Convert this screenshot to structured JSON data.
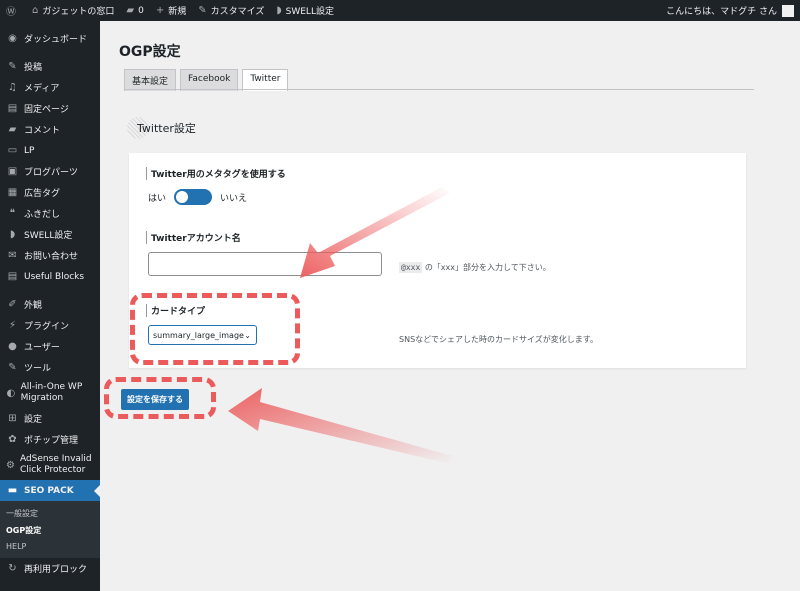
{
  "adminbar": {
    "wp_icon": "wordpress-icon",
    "site_name": "ガジェットの窓口",
    "comments_count": "0",
    "new_label": "新規",
    "customize_label": "カスタマイズ",
    "swell_label": "SWELL設定",
    "greeting": "こんにちは、マドグチ さん"
  },
  "sidebar": {
    "items": [
      {
        "icon": "dashboard-icon",
        "label": "ダッシュボード"
      },
      {
        "icon": "pin-icon",
        "label": "投稿"
      },
      {
        "icon": "media-icon",
        "label": "メディア"
      },
      {
        "icon": "page-icon",
        "label": "固定ページ"
      },
      {
        "icon": "comment-icon",
        "label": "コメント"
      },
      {
        "icon": "lp-icon",
        "label": "LP"
      },
      {
        "icon": "blog-parts-icon",
        "label": "ブログパーツ"
      },
      {
        "icon": "ad-tag-icon",
        "label": "広告タグ"
      },
      {
        "icon": "balloon-icon",
        "label": "ふきだし"
      },
      {
        "icon": "swell-icon",
        "label": "SWELL設定"
      },
      {
        "icon": "mail-icon",
        "label": "お問い合わせ"
      },
      {
        "icon": "blocks-icon",
        "label": "Useful Blocks"
      },
      {
        "icon": "appearance-icon",
        "label": "外観"
      },
      {
        "icon": "plugin-icon",
        "label": "プラグイン"
      },
      {
        "icon": "user-icon",
        "label": "ユーザー"
      },
      {
        "icon": "tool-icon",
        "label": "ツール"
      },
      {
        "icon": "migration-icon",
        "label": "All-in-One WP Migration"
      },
      {
        "icon": "settings-icon",
        "label": "設定"
      },
      {
        "icon": "pochipp-icon",
        "label": "ポチップ管理"
      },
      {
        "icon": "adsense-icon",
        "label": "AdSense Invalid Click Protector"
      },
      {
        "icon": "seo-pack-icon",
        "label": "SEO PACK"
      },
      {
        "icon": "reuse-block-icon",
        "label": "再利用ブロック"
      }
    ],
    "submenu": [
      "一般設定",
      "OGP設定",
      "HELP"
    ]
  },
  "main": {
    "title": "OGP設定",
    "tabs": [
      "基本設定",
      "Facebook",
      "Twitter"
    ],
    "section_title": "Twitter設定",
    "meta_label": "Twitter用のメタタグを使用する",
    "toggle_yes": "はい",
    "toggle_no": "いいえ",
    "toggle_state": "on",
    "account_label": "Twitterアカウント名",
    "account_value": "",
    "account_help_code": "@xxx",
    "account_help_text": "の「xxx」部分を入力して下さい。",
    "card_label": "カードタイプ",
    "card_value": "summary_large_image",
    "card_help": "SNSなどでシェアした時のカードサイズが変化します。",
    "save_label": "設定を保存する"
  },
  "colors": {
    "accent": "#2271b1",
    "highlight": "#ec5b5b",
    "adminbar": "#1d2327"
  }
}
